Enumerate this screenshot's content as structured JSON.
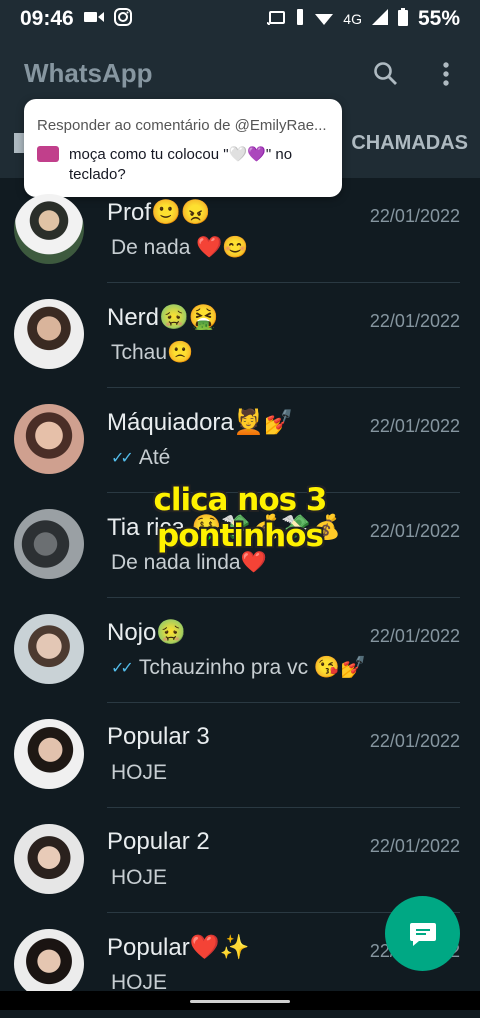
{
  "status_bar": {
    "time": "09:46",
    "network": "4G",
    "battery": "55%"
  },
  "header": {
    "title": "WhatsApp",
    "calls_tab": "CHAMADAS"
  },
  "reply_popup": {
    "title": "Responder ao comentário de @EmilyRae...",
    "body": "moça como tu colocou \"🤍💜\" no teclado?"
  },
  "overlay_caption": "clica nos 3 pontinhos",
  "chats": [
    {
      "name": "Prof🙂😠",
      "date": "22/01/2022",
      "preview": "De nada ❤️😊",
      "read": false
    },
    {
      "name": "Nerd🤢🤮",
      "date": "22/01/2022",
      "preview": "Tchau🙁",
      "read": false
    },
    {
      "name": "Máquiadora💆💅",
      "date": "22/01/2022",
      "preview": "Até",
      "read": true
    },
    {
      "name": "Tia rica 🤑💸💰💸💰",
      "date": "22/01/2022",
      "preview": "De nada linda❤️",
      "read": false
    },
    {
      "name": "Nojo🤢",
      "date": "22/01/2022",
      "preview": "Tchauzinho pra vc 😘💅",
      "read": true
    },
    {
      "name": "Popular 3",
      "date": "22/01/2022",
      "preview": "HOJE",
      "read": false
    },
    {
      "name": "Popular 2",
      "date": "22/01/2022",
      "preview": "HOJE",
      "read": false
    },
    {
      "name": "Popular❤️✨",
      "date": "22/01/2022",
      "preview": "HOJE",
      "read": false
    }
  ],
  "colors": {
    "background": "#111b21",
    "header": "#1f2c34",
    "accent": "#00a884",
    "read_check": "#53bdeb",
    "caption": "#fff200"
  },
  "icons": [
    "search-icon",
    "menu-icon",
    "double-check-icon",
    "new-chat-icon",
    "camera-icon"
  ]
}
